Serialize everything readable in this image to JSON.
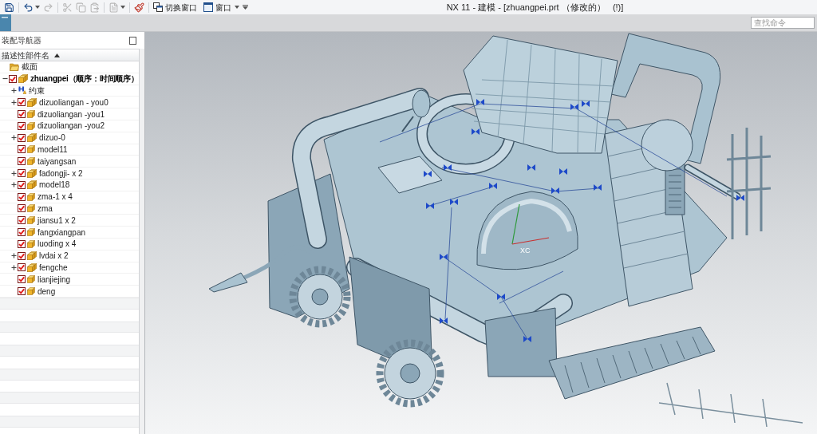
{
  "window": {
    "title": "NX 11 - 建模 - [zhuangpei.prt （修改的）   (!)]"
  },
  "quick_access": [
    {
      "disabled": false,
      "dropdown": false
    },
    {
      "disabled": false,
      "dropdown": true
    },
    {
      "disabled": true,
      "dropdown": false
    },
    {
      "disabled": true,
      "dropdown": false
    },
    {
      "disabled": true,
      "dropdown": false
    },
    {
      "disabled": true,
      "dropdown": false
    },
    {
      "disabled": true,
      "dropdown": true
    },
    {
      "disabled": false,
      "dropdown": false
    }
  ],
  "window_buttons": [
    {
      "label": "切换窗口",
      "dropdown": false
    },
    {
      "label": "窗口",
      "dropdown": true
    }
  ],
  "command_search": {
    "placeholder": "查找命令"
  },
  "navigator": {
    "title": "装配导航器",
    "column": {
      "label": "描述性部件名",
      "sorted_ascending": true
    },
    "tree": [
      {
        "label": "截面",
        "kind": "folder",
        "current": false
      },
      {
        "label": "zhuangpei（顺序：时间顺序）",
        "kind": "assembly",
        "checked": true,
        "expanded": true,
        "current": true,
        "children": [
          {
            "label": "约束",
            "kind": "constraints",
            "expanded": false,
            "current": false
          },
          {
            "label": "dizuoliangan - you0",
            "kind": "assembly",
            "checked": true,
            "expanded": false,
            "current": false
          },
          {
            "label": "dizuoliangan -you1",
            "kind": "part",
            "checked": true,
            "current": false
          },
          {
            "label": "dizuoliangan -you2",
            "kind": "part",
            "checked": true,
            "current": false
          },
          {
            "label": "dizuo-0",
            "kind": "assembly",
            "checked": true,
            "expanded": false,
            "current": false
          },
          {
            "label": "model11",
            "kind": "part",
            "checked": true,
            "current": false
          },
          {
            "label": "taiyangsan",
            "kind": "part",
            "checked": true,
            "current": false
          },
          {
            "label": "fadongji- x 2",
            "kind": "assembly",
            "checked": true,
            "expanded": false,
            "current": false
          },
          {
            "label": "model18",
            "kind": "assembly",
            "checked": true,
            "expanded": false,
            "current": false
          },
          {
            "label": "zma-1 x 4",
            "kind": "part",
            "checked": true,
            "current": false
          },
          {
            "label": "zma",
            "kind": "part",
            "checked": true,
            "current": false
          },
          {
            "label": "jiansu1 x 2",
            "kind": "part",
            "checked": true,
            "current": false
          },
          {
            "label": "fangxiangpan",
            "kind": "part",
            "checked": true,
            "current": false
          },
          {
            "label": "luoding x 4",
            "kind": "part",
            "checked": true,
            "current": false
          },
          {
            "label": "lvdai x 2",
            "kind": "assembly",
            "checked": true,
            "expanded": false,
            "current": false
          },
          {
            "label": "fengche",
            "kind": "assembly",
            "checked": true,
            "expanded": false,
            "current": false
          },
          {
            "label": "lianjiejing",
            "kind": "part",
            "checked": true,
            "current": false
          },
          {
            "label": "deng",
            "kind": "part",
            "checked": true,
            "current": false
          }
        ]
      }
    ]
  },
  "viewport": {
    "axis_label": "XC"
  }
}
